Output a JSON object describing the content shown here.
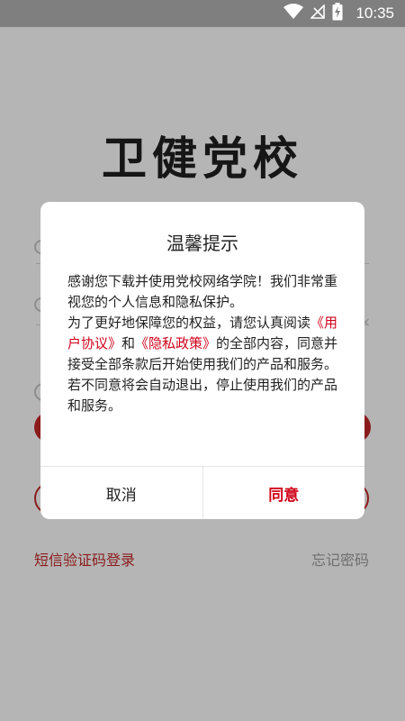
{
  "status_bar": {
    "time": "10:35"
  },
  "app": {
    "logo": "卫健党校",
    "sms_login": "短信验证码登录",
    "forgot_password": "忘记密码"
  },
  "dialog": {
    "title": "温馨提示",
    "para1": "感谢您下载并使用党校网络学院！我们非常重视您的个人信息和隐私保护。",
    "para2_prefix": "为了更好地保障您的权益，请您认真阅读",
    "user_agreement": "《用户协议》",
    "and": "和",
    "privacy_policy": "《隐私政策》",
    "para2_suffix": "的全部内容，同意并接受全部条款后开始使用我们的产品和服务。",
    "para3": "若不同意将会自动退出，停止使用我们的产品和服务。",
    "cancel_label": "取消",
    "agree_label": "同意"
  },
  "colors": {
    "accent": "#d0021b",
    "overlay_bg": "#b5b5b5",
    "status_bar": "#7f7f7f"
  },
  "icons": [
    "wifi-icon",
    "signal-icon",
    "battery-icon"
  ]
}
